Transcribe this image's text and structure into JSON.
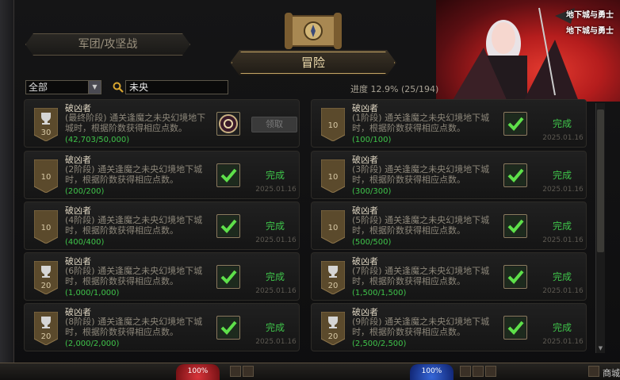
{
  "header": {
    "legion_tab": "军团/攻坚战",
    "adventure_tab": "冒险",
    "banner_logo": "地下城与勇士"
  },
  "filter": {
    "category": "全部",
    "search_value": "未央",
    "progress_label": "进度",
    "progress_pct": "12.9%",
    "progress_count": "(25/194)"
  },
  "cards": [
    {
      "title": "破凶者",
      "desc": "(最终阶段) 通关逢魔之未央幻境地下城时，根据阶数获得相应点数。",
      "progress": "(42,703/50,000)",
      "badge": "30",
      "badge_kind": "trophy",
      "state": "claim",
      "claim_label": "领取"
    },
    {
      "title": "破凶者",
      "desc": "(1阶段) 通关逢魔之未央幻境地下城时，根据阶数获得相应点数。",
      "progress": "(100/100)",
      "badge": "10",
      "badge_kind": "plain",
      "state": "done",
      "status": "完成",
      "date": "2025.01.16"
    },
    {
      "title": "破凶者",
      "desc": "(2阶段) 通关逢魔之未央幻境地下城时，根据阶数获得相应点数。",
      "progress": "(200/200)",
      "badge": "10",
      "badge_kind": "plain",
      "state": "done",
      "status": "完成",
      "date": "2025.01.16"
    },
    {
      "title": "破凶者",
      "desc": "(3阶段) 通关逢魔之未央幻境地下城时，根据阶数获得相应点数。",
      "progress": "(300/300)",
      "badge": "10",
      "badge_kind": "plain",
      "state": "done",
      "status": "完成",
      "date": "2025.01.16"
    },
    {
      "title": "破凶者",
      "desc": "(4阶段) 通关逢魔之未央幻境地下城时，根据阶数获得相应点数。",
      "progress": "(400/400)",
      "badge": "10",
      "badge_kind": "plain",
      "state": "done",
      "status": "完成",
      "date": "2025.01.16"
    },
    {
      "title": "破凶者",
      "desc": "(5阶段) 通关逢魔之未央幻境地下城时，根据阶数获得相应点数。",
      "progress": "(500/500)",
      "badge": "10",
      "badge_kind": "plain",
      "state": "done",
      "status": "完成",
      "date": "2025.01.16"
    },
    {
      "title": "破凶者",
      "desc": "(6阶段) 通关逢魔之未央幻境地下城时，根据阶数获得相应点数。",
      "progress": "(1,000/1,000)",
      "badge": "20",
      "badge_kind": "trophy",
      "state": "done",
      "status": "完成",
      "date": "2025.01.16"
    },
    {
      "title": "破凶者",
      "desc": "(7阶段) 通关逢魔之未央幻境地下城时，根据阶数获得相应点数。",
      "progress": "(1,500/1,500)",
      "badge": "20",
      "badge_kind": "trophy",
      "state": "done",
      "status": "完成",
      "date": "2025.01.16"
    },
    {
      "title": "破凶者",
      "desc": "(8阶段) 通关逢魔之未央幻境地下城时，根据阶数获得相应点数。",
      "progress": "(2,000/2,000)",
      "badge": "20",
      "badge_kind": "trophy",
      "state": "done",
      "status": "完成",
      "date": "2025.01.16"
    },
    {
      "title": "破凶者",
      "desc": "(9阶段) 通关逢魔之未央幻境地下城时，根据阶数获得相应点数。",
      "progress": "(2,500/2,500)",
      "badge": "20",
      "badge_kind": "trophy",
      "state": "done",
      "status": "完成",
      "date": "2025.01.16"
    }
  ],
  "hud": {
    "hp_text": "100%",
    "mp_text": "100%",
    "shop_label": "商城"
  },
  "colors": {
    "accent_gold": "#c7a766",
    "complete_green": "#3fc34a",
    "banner_red": "#b51d1d"
  },
  "icons": [
    "search-icon",
    "trophy-icon",
    "checkmark-icon",
    "scroll-emblem-icon",
    "reward-emblem-icon",
    "dropdown-arrow-icon"
  ]
}
